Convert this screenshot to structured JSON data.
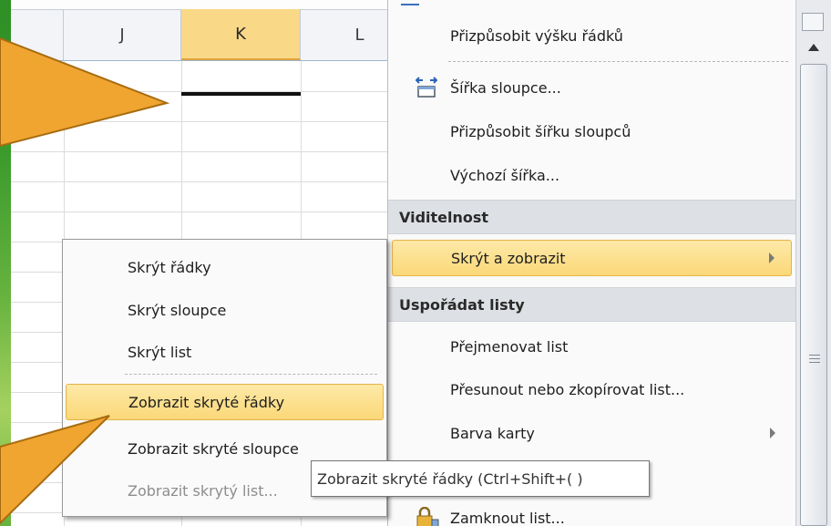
{
  "spreadsheet": {
    "columns": [
      "J",
      "K",
      "L"
    ],
    "selected_column": "K"
  },
  "main_menu": {
    "items_top": [
      {
        "label": "Přizpůsobit výšku řádků",
        "icon": ""
      },
      {
        "label": "Šířka sloupce...",
        "icon": "column-width-icon"
      },
      {
        "label": "Přizpůsobit šířku sloupců",
        "icon": ""
      },
      {
        "label": "Výchozí šířka...",
        "icon": ""
      }
    ],
    "section_visibility": "Viditelnost",
    "hide_show": {
      "label": "Skrýt a zobrazit",
      "highlighted": true
    },
    "section_organize": "Uspořádat listy",
    "items_organize": [
      {
        "label": "Přejmenovat list"
      },
      {
        "label": "Přesunout nebo zkopírovat list..."
      },
      {
        "label": "Barva karty"
      }
    ],
    "protect_item": {
      "label": "Zamknout list...",
      "icon": "lock-icon"
    }
  },
  "submenu": {
    "items": [
      {
        "label": "Skrýt řádky"
      },
      {
        "label": "Skrýt sloupce"
      },
      {
        "label": "Skrýt list"
      },
      {
        "label": "Zobrazit skryté řádky",
        "highlighted": true
      },
      {
        "label": "Zobrazit skryté sloupce"
      },
      {
        "label": "Zobrazit skrytý list...",
        "disabled": true
      }
    ]
  },
  "tooltip": {
    "text": "Zobrazit skryté řádky (Ctrl+Shift+( )"
  },
  "colors": {
    "highlight": "#fbd878",
    "arrow": "#f0a531",
    "background": "#3a9a2c"
  }
}
